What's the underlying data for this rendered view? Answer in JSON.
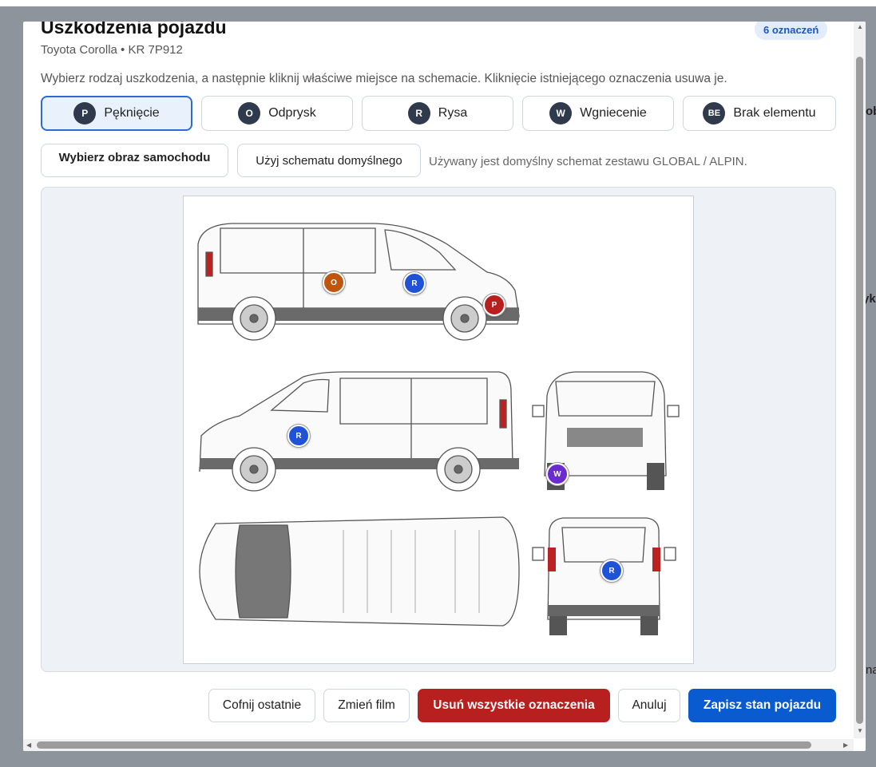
{
  "background": {
    "right_fragments": [
      "ob",
      "yk",
      "na"
    ]
  },
  "modal": {
    "title": "Uszkodzenia pojazdu",
    "subtitle": "Toyota Corolla • KR 7P912",
    "badge": "6 oznaczeń",
    "instruction": "Wybierz rodzaj uszkodzenia, a następnie kliknij właściwe miejsce na schemacie. Kliknięcie istniejącego oznaczenia usuwa je.",
    "damage_types": [
      {
        "code": "P",
        "label": "Pęknięcie",
        "active": true
      },
      {
        "code": "O",
        "label": "Odprysk",
        "active": false
      },
      {
        "code": "R",
        "label": "Rysa",
        "active": false
      },
      {
        "code": "W",
        "label": "Wgniecenie",
        "active": false
      },
      {
        "code": "BE",
        "label": "Brak elementu",
        "active": false
      }
    ],
    "choose_image_label": "Wybierz obraz samochodu",
    "use_default_label": "Użyj schematu domyślnego",
    "image_status": "Używany jest domyślny schemat zestawu GLOBAL / ALPIN.",
    "markers": [
      {
        "code": "O",
        "color": "#c0560e"
      },
      {
        "code": "R",
        "color": "#1f52d6"
      },
      {
        "code": "P",
        "color": "#b81f1f"
      },
      {
        "code": "R",
        "color": "#1f52d6"
      },
      {
        "code": "W",
        "color": "#6a2bd1"
      },
      {
        "code": "R",
        "color": "#1f52d6"
      }
    ],
    "footer": {
      "undo_label": "Cofnij ostatnie",
      "change_film_label": "Zmień film",
      "clear_all_label": "Usuń wszystkie oznaczenia",
      "cancel_label": "Anuluj",
      "save_label": "Zapisz stan pojazdu"
    }
  }
}
